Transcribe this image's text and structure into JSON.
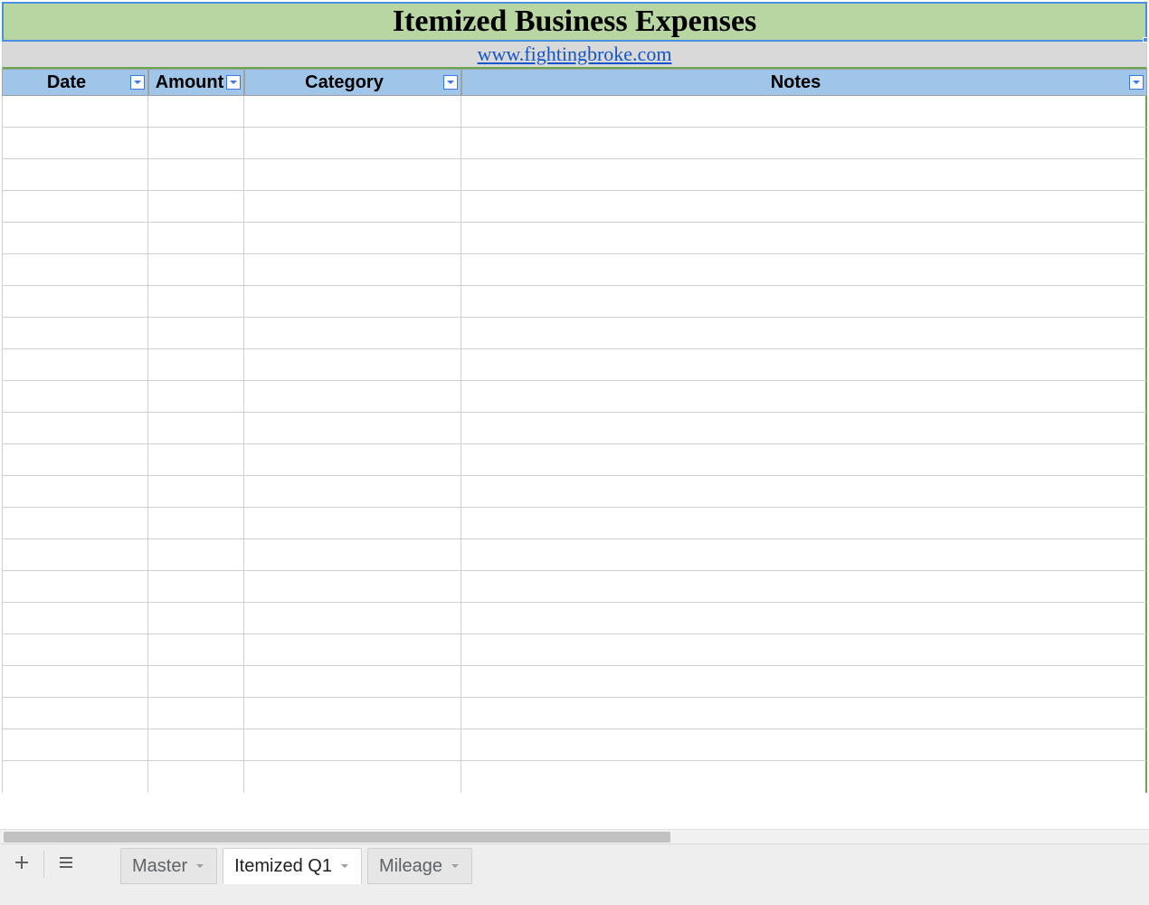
{
  "sheet": {
    "title": "Itemized Business Expenses",
    "link_text": "www.fightingbroke.com",
    "link_href": "http://www.fightingbroke.com",
    "columns": [
      {
        "key": "date",
        "label": "Date",
        "filter": true
      },
      {
        "key": "amount",
        "label": "Amount",
        "filter": true
      },
      {
        "key": "category",
        "label": "Category",
        "filter": true
      },
      {
        "key": "notes",
        "label": "Notes",
        "filter": true
      }
    ],
    "rows": [
      {
        "date": "",
        "amount": "",
        "category": "",
        "notes": ""
      },
      {
        "date": "",
        "amount": "",
        "category": "",
        "notes": ""
      },
      {
        "date": "",
        "amount": "",
        "category": "",
        "notes": ""
      },
      {
        "date": "",
        "amount": "",
        "category": "",
        "notes": ""
      },
      {
        "date": "",
        "amount": "",
        "category": "",
        "notes": ""
      },
      {
        "date": "",
        "amount": "",
        "category": "",
        "notes": ""
      },
      {
        "date": "",
        "amount": "",
        "category": "",
        "notes": ""
      },
      {
        "date": "",
        "amount": "",
        "category": "",
        "notes": ""
      },
      {
        "date": "",
        "amount": "",
        "category": "",
        "notes": ""
      },
      {
        "date": "",
        "amount": "",
        "category": "",
        "notes": ""
      },
      {
        "date": "",
        "amount": "",
        "category": "",
        "notes": ""
      },
      {
        "date": "",
        "amount": "",
        "category": "",
        "notes": ""
      },
      {
        "date": "",
        "amount": "",
        "category": "",
        "notes": ""
      },
      {
        "date": "",
        "amount": "",
        "category": "",
        "notes": ""
      },
      {
        "date": "",
        "amount": "",
        "category": "",
        "notes": ""
      },
      {
        "date": "",
        "amount": "",
        "category": "",
        "notes": ""
      },
      {
        "date": "",
        "amount": "",
        "category": "",
        "notes": ""
      },
      {
        "date": "",
        "amount": "",
        "category": "",
        "notes": ""
      },
      {
        "date": "",
        "amount": "",
        "category": "",
        "notes": ""
      },
      {
        "date": "",
        "amount": "",
        "category": "",
        "notes": ""
      },
      {
        "date": "",
        "amount": "",
        "category": "",
        "notes": ""
      },
      {
        "date": "",
        "amount": "",
        "category": "",
        "notes": ""
      }
    ]
  },
  "tabs": {
    "items": [
      {
        "label": "Master",
        "active": false
      },
      {
        "label": "Itemized Q1",
        "active": true
      },
      {
        "label": "Mileage",
        "active": false
      }
    ]
  },
  "colors": {
    "title_bg": "#b8d6a2",
    "selection_border": "#4a90e2",
    "link_bg": "#d9d9d9",
    "header_bg": "#9fc5e8",
    "accent_green": "#6aa84f",
    "link_color": "#1155cc"
  }
}
